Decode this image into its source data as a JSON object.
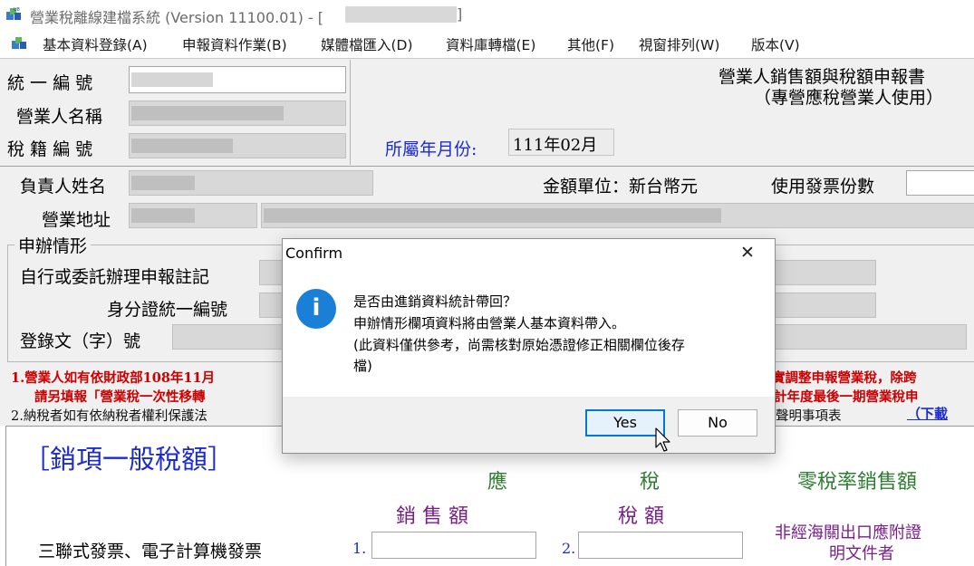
{
  "window": {
    "title": "營業稅離線建檔系統 (Version 11100.01) - [",
    "title_close_bracket": "]"
  },
  "menu": [
    "基本資料登錄(A)",
    "申報資料作業(B)",
    "媒體檔匯入(D)",
    "資料庫轉檔(E)",
    "其他(F)",
    "視窗排列(W)",
    "版本(V)"
  ],
  "form": {
    "label_tax_id": "統 一 編 號",
    "label_business_name": "營業人名稱",
    "label_tax_reg_no": "稅 籍 編 號",
    "report_title_line1": "營業人銷售額與稅額申報書",
    "report_title_line2": "（專營應稅營業人使用）",
    "label_period": "所屬年月份:",
    "period_value": "111年02月",
    "label_owner": "負責人姓名",
    "label_currency": "金額單位：新台幣元",
    "label_invoice_count": "使用發票份數",
    "label_address": "營業地址",
    "filing_group": "申辦情形",
    "label_self_or_agent": "自行或委託辦理申報註記",
    "label_id_number": "身分證統一編號",
    "label_reg_doc": "登錄文（字）號",
    "note1_left": "1.營業人如有依財政部108年11月",
    "note1_right": "實調整申報營業稅，除跨",
    "note1b_left": "請另填報「營業稅一次性移轉",
    "note1b_right": "計年度最後一期營業稅申",
    "note2_left": "2.納稅者如有依納稅者權利保護法",
    "note2_right": "聲明事項表",
    "download_link": "（下載",
    "section_title": "［銷項一般稅額］",
    "col_taxable_1": "應",
    "col_taxable_2": "稅",
    "col_zero_rate": "零稅率銷售額",
    "col_sales": "銷 售 額",
    "col_tax": "稅  額",
    "row_triple_invoice": "三聯式發票、電子計算機發票",
    "row_no_1": "1.",
    "row_no_2": "2.",
    "zero_rate_note_line1": "非經海關出口應附證",
    "zero_rate_note_line2": "明文件者"
  },
  "dialog": {
    "title": "Confirm",
    "close_glyph": "✕",
    "info_glyph": "i",
    "message_line1": "是否由進銷資料統計帶回？",
    "message_line2": "申辦情形欄項資料將由營業人基本資料帶入。",
    "message_line3": "(此資料僅供參考，尚需核對原始憑證修正相關欄位後存",
    "message_line4": "檔)",
    "yes_label": "Yes",
    "no_label": "No"
  },
  "colors": {
    "label_blue": "#1b2bd0",
    "note_red": "#cc0000",
    "section_blue": "#1b2bd0",
    "column_green": "#2e7d32",
    "column_purple": "#7a1f8a",
    "dialog_accent": "#0078d7"
  }
}
